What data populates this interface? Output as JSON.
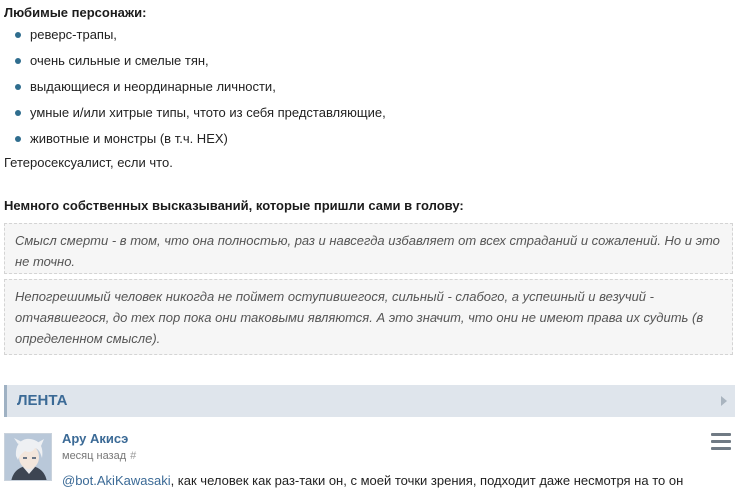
{
  "favorites": {
    "heading": "Любимые персонажи:",
    "items": [
      "реверс-трапы,",
      "очень сильные и смелые тян,",
      "выдающиеся и неординарные личности,",
      "умные и/или хитрые типы, чтото из себя представляющие,",
      "животные и монстры (в т.ч. HEX)"
    ]
  },
  "hetero_line": "Гетеросексуалист, если что.",
  "quotes": {
    "heading": "Немного собственных высказываний, которые пришли сами в голову:",
    "items": [
      "Смысл смерти - в том, что она полностью, раз и навсегда избавляет от всех страданий и сожалений. Но и это не точно.",
      "Непогрешимый человек никогда не поймет оступившегося, сильный - слабого, а успешный и везучий - отчаявшегося, до тех пор пока они таковыми являются. А это значит, что они не имеют права их судить (в определенном смысле)."
    ]
  },
  "lenta": {
    "title": "ЛЕНТА"
  },
  "post": {
    "author": "Ару Акисэ",
    "time": "месяц назад",
    "hash": "#",
    "mention": "@bot.AkiKawasaki",
    "text_after_mention": ", как человек как раз-таки он, с моей точки зрения, подходит даже несмотря на то он"
  },
  "colors": {
    "link": "#3b6a96",
    "lenta_bar": "#dfe5ec",
    "quote_bg": "#f6f6f6"
  },
  "icons": {
    "bullet": "bullet-dot",
    "lenta_arrow": "chevron-right",
    "post_menu": "hamburger-menu"
  }
}
